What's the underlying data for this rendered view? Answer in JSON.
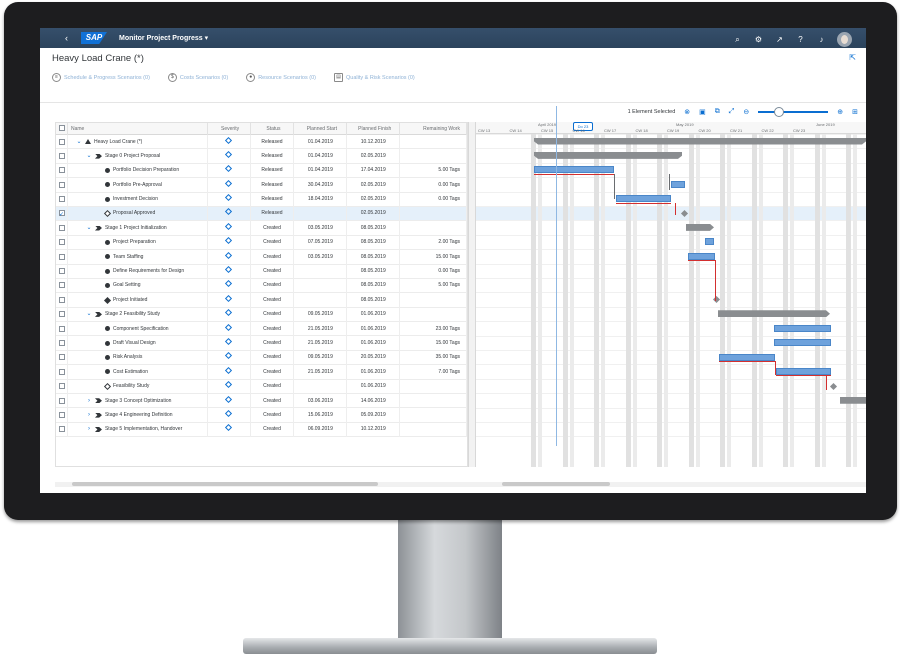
{
  "shell": {
    "logo": "SAP",
    "app_title": "Monitor Project Progress ▾",
    "icons": [
      "search-icon",
      "settings-icon",
      "share-icon",
      "help-icon",
      "notification-icon"
    ]
  },
  "object": {
    "title": "Heavy Load Crane (*)",
    "subsections": [
      {
        "label": "Schedule & Progress Scenarios (0)",
        "icon": "gantt-icon"
      },
      {
        "label": "Costs Scenarios (0)",
        "icon": "dollar-icon"
      },
      {
        "label": "Resource Scenarios (0)",
        "icon": "person-icon"
      },
      {
        "label": "Quality & Risk Scenarios (0)",
        "icon": "quality-icon"
      }
    ]
  },
  "toolbar": {
    "selection": "1 Element Selected",
    "zoom_level": 0.25
  },
  "table": {
    "headers": [
      "Name",
      "Severity",
      "Status",
      "Planned Start",
      "Planned Finish",
      "Remaining Work"
    ],
    "rows": [
      {
        "name": "Heavy Load Crane (*)",
        "indent": 0,
        "expander": "v",
        "icon": "tri",
        "status": "Released",
        "start": "01.04.2019",
        "finish": "10.12.2019",
        "work": "",
        "sel": false
      },
      {
        "name": "Stage 0 Project Proposal",
        "indent": 1,
        "expander": "v",
        "icon": "chev",
        "status": "Released",
        "start": "01.04.2019",
        "finish": "02.05.2019",
        "work": "",
        "sel": false
      },
      {
        "name": "Portfolio Decision Preparation",
        "indent": 2,
        "expander": "",
        "icon": "dot",
        "status": "Released",
        "start": "01.04.2019",
        "finish": "17.04.2019",
        "work": "5.00 Tags",
        "sel": false
      },
      {
        "name": "Portfolio Pre-Approval",
        "indent": 2,
        "expander": "",
        "icon": "dot",
        "status": "Released",
        "start": "30.04.2019",
        "finish": "02.05.2019",
        "work": "0.00 Tags",
        "sel": false
      },
      {
        "name": "Investment Decision",
        "indent": 2,
        "expander": "",
        "icon": "dot",
        "status": "Released",
        "start": "18.04.2019",
        "finish": "02.05.2019",
        "work": "0.00 Tags",
        "sel": false
      },
      {
        "name": "Proposal Approved",
        "indent": 2,
        "expander": "",
        "icon": "diao",
        "status": "Released",
        "start": "",
        "finish": "02.05.2019",
        "work": "",
        "sel": true
      },
      {
        "name": "Stage 1 Project Initialization",
        "indent": 1,
        "expander": "v",
        "icon": "chev",
        "status": "Created",
        "start": "03.05.2019",
        "finish": "08.05.2019",
        "work": "",
        "sel": false
      },
      {
        "name": "Project Preparation",
        "indent": 2,
        "expander": "",
        "icon": "dot",
        "status": "Created",
        "start": "07.05.2019",
        "finish": "08.05.2019",
        "work": "2.00 Tags",
        "sel": false
      },
      {
        "name": "Team Staffing",
        "indent": 2,
        "expander": "",
        "icon": "dot",
        "status": "Created",
        "start": "03.05.2019",
        "finish": "08.05.2019",
        "work": "15.00 Tags",
        "sel": false
      },
      {
        "name": "Define Requirements for Design",
        "indent": 2,
        "expander": "",
        "icon": "dot",
        "status": "Created",
        "start": "",
        "finish": "08.05.2019",
        "work": "0.00 Tags",
        "sel": false
      },
      {
        "name": "Goal Setting",
        "indent": 2,
        "expander": "",
        "icon": "dot",
        "status": "Created",
        "start": "",
        "finish": "08.05.2019",
        "work": "5.00 Tags",
        "sel": false
      },
      {
        "name": "Project Initiated",
        "indent": 2,
        "expander": "",
        "icon": "dia",
        "status": "Created",
        "start": "",
        "finish": "08.05.2019",
        "work": "",
        "sel": false
      },
      {
        "name": "Stage 2 Feasibility Study",
        "indent": 1,
        "expander": "v",
        "icon": "chev",
        "status": "Created",
        "start": "09.05.2019",
        "finish": "01.06.2019",
        "work": "",
        "sel": false
      },
      {
        "name": "Component Specification",
        "indent": 2,
        "expander": "",
        "icon": "dot",
        "status": "Created",
        "start": "21.05.2019",
        "finish": "01.06.2019",
        "work": "23.00 Tags",
        "sel": false
      },
      {
        "name": "Draft Visual Design",
        "indent": 2,
        "expander": "",
        "icon": "dot",
        "status": "Created",
        "start": "21.05.2019",
        "finish": "01.06.2019",
        "work": "15.00 Tags",
        "sel": false
      },
      {
        "name": "Risk Analysis",
        "indent": 2,
        "expander": "",
        "icon": "dot",
        "status": "Created",
        "start": "09.05.2019",
        "finish": "20.05.2019",
        "work": "35.00 Tags",
        "sel": false
      },
      {
        "name": "Cost Estimation",
        "indent": 2,
        "expander": "",
        "icon": "dot",
        "status": "Created",
        "start": "21.05.2019",
        "finish": "01.06.2019",
        "work": "7.00 Tags",
        "sel": false
      },
      {
        "name": "Feasibility Study",
        "indent": 2,
        "expander": "",
        "icon": "diao",
        "status": "Created",
        "start": "",
        "finish": "01.06.2019",
        "work": "",
        "sel": false
      },
      {
        "name": "Stage 3 Concept Optimization",
        "indent": 1,
        "expander": ">",
        "icon": "chev",
        "status": "Created",
        "start": "03.06.2019",
        "finish": "14.06.2019",
        "work": "",
        "sel": false
      },
      {
        "name": "Stage 4 Engineering Definition",
        "indent": 1,
        "expander": ">",
        "icon": "chev",
        "status": "Created",
        "start": "15.06.2019",
        "finish": "05.09.2019",
        "work": "",
        "sel": false
      },
      {
        "name": "Stage 5 Implementation, Handover",
        "indent": 1,
        "expander": ">",
        "icon": "chev",
        "status": "Created",
        "start": "06.09.2019",
        "finish": "10.12.2019",
        "work": "",
        "sel": false
      }
    ]
  },
  "gantt": {
    "months": [
      "April 2019",
      "May 2019",
      "June 2019"
    ],
    "weeks": [
      "CW 13",
      "CW 14",
      "CW 15",
      "CW 16",
      "CW 17",
      "CW 18",
      "CW 19",
      "CW 20",
      "CW 21",
      "CW 22",
      "CW 23"
    ],
    "today_label": "Do 23"
  }
}
